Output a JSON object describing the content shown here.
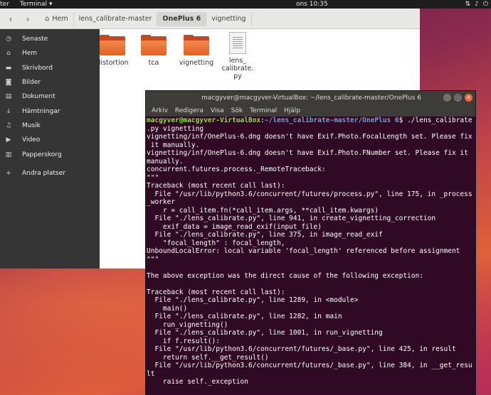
{
  "topbar": {
    "activities": "ter",
    "app_menu": "Terminal",
    "clock": "ons 10:35",
    "tray_icons": [
      "network-icon",
      "volume-icon",
      "power-icon"
    ]
  },
  "files": {
    "breadcrumbs": [
      {
        "label": "Hem",
        "icon": "home-icon"
      },
      {
        "label": "lens_calibrate-master"
      },
      {
        "label": "OnePlus 6",
        "active": true
      },
      {
        "label": "vignetting"
      }
    ],
    "sidebar": [
      {
        "label": "Senaste",
        "icon": "clock-icon",
        "glyph": "◷"
      },
      {
        "label": "Hem",
        "icon": "home-icon",
        "glyph": "⌂"
      },
      {
        "label": "Skrivbord",
        "icon": "desktop-icon",
        "glyph": "▬"
      },
      {
        "label": "Bilder",
        "icon": "camera-icon",
        "glyph": "◙"
      },
      {
        "label": "Dokument",
        "icon": "document-icon",
        "glyph": "▤"
      },
      {
        "label": "Hämtningar",
        "icon": "download-icon",
        "glyph": "↓"
      },
      {
        "label": "Musik",
        "icon": "music-icon",
        "glyph": "♫"
      },
      {
        "label": "Video",
        "icon": "video-icon",
        "glyph": "▶"
      },
      {
        "label": "Papperskorg",
        "icon": "trash-icon",
        "glyph": "▥"
      },
      {
        "label": "Andra platser",
        "icon": "plus-icon",
        "glyph": "+"
      }
    ],
    "items": [
      {
        "label": "distortion",
        "type": "folder"
      },
      {
        "label": "tca",
        "type": "folder"
      },
      {
        "label": "vignetting",
        "type": "folder"
      },
      {
        "label": "lens_\ncalibrate.\npy",
        "type": "file"
      }
    ]
  },
  "terminal": {
    "title": "macgyver@macgyver-VirtualBox: ~/lens_calibrate-master/OnePlus 6",
    "menu": [
      "Arkiv",
      "Redigera",
      "Visa",
      "Sök",
      "Terminal",
      "Hjälp"
    ],
    "prompt_user": "macgyver@macgyver-VirtualBox",
    "prompt_path": "~/lens_calibrate-master/OnePlus 6",
    "command_line_1": "$ ./lens_calibrate",
    "output": ".py vignetting\nvignetting/inf/OnePlus-6.dng doesn't have Exif.Photo.FocalLength set. Please fix\n it manually.\nvignetting/inf/OnePlus-6.dng doesn't have Exif.Photo.FNumber set. Please fix it\nmanually.\nconcurrent.futures.process._RemoteTraceback:\n\"\"\"\nTraceback (most recent call last):\n  File \"/usr/lib/python3.6/concurrent/futures/process.py\", line 175, in _process\n_worker\n    r = call_item.fn(*call_item.args, **call_item.kwargs)\n  File \"./lens_calibrate.py\", line 941, in create_vignetting_correction\n    exif_data = image_read_exif(input_file)\n  File \"./lens_calibrate.py\", line 375, in image_read_exif\n    \"focal_length\" : focal_length,\nUnboundLocalError: local variable 'focal_length' referenced before assignment\n\"\"\"\n\nThe above exception was the direct cause of the following exception:\n\nTraceback (most recent call last):\n  File \"./lens_calibrate.py\", line 1289, in <module>\n    main()\n  File \"./lens_calibrate.py\", line 1282, in main\n    run_vignetting()\n  File \"./lens_calibrate.py\", line 1001, in run_vignetting\n    if f.result():\n  File \"/usr/lib/python3.6/concurrent/futures/_base.py\", line 425, in result\n    return self.__get_result()\n  File \"/usr/lib/python3.6/concurrent/futures/_base.py\", line 384, in __get_resu\nlt\n    raise self._exception"
  }
}
